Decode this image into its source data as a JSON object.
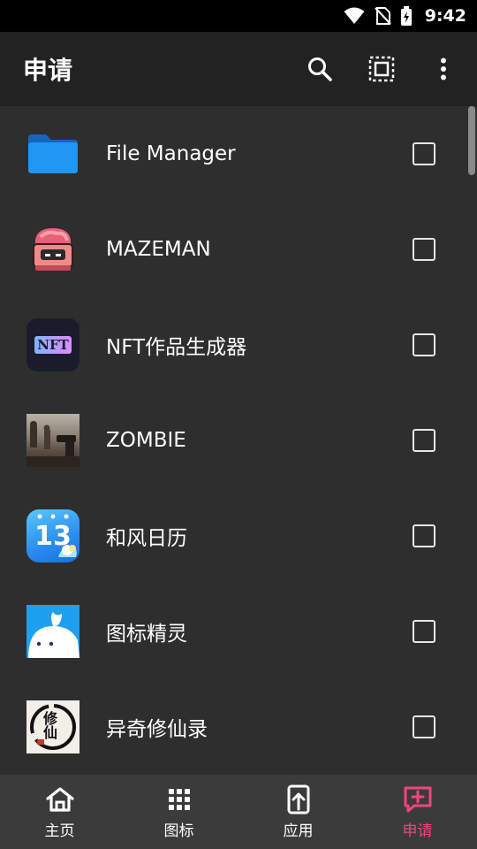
{
  "status_bar": {
    "time": "9:42",
    "icons": [
      "wifi-icon",
      "no-sim-icon",
      "battery-charging-icon"
    ]
  },
  "app_bar": {
    "title": "申请",
    "actions": [
      "search-icon",
      "select-all-icon",
      "more-vert-icon"
    ]
  },
  "apps": [
    {
      "name": "File Manager",
      "icon": "folder-icon",
      "checked": false
    },
    {
      "name": "MAZEMAN",
      "icon": "mazeman-icon",
      "checked": false
    },
    {
      "name": "NFT作品生成器",
      "icon": "nft-icon",
      "icon_text": "NFT",
      "checked": false
    },
    {
      "name": "ZOMBIE",
      "icon": "zombie-icon",
      "checked": false
    },
    {
      "name": "和风日历",
      "icon": "calendar-icon",
      "icon_text": "13",
      "checked": false
    },
    {
      "name": "图标精灵",
      "icon": "whale-icon",
      "checked": false
    },
    {
      "name": "异奇修仙录",
      "icon": "xiuxian-icon",
      "icon_text": "修仙",
      "checked": false
    }
  ],
  "bottom_nav": {
    "items": [
      {
        "label": "主页",
        "icon": "home-icon",
        "active": false
      },
      {
        "label": "图标",
        "icon": "grid-icon",
        "active": false
      },
      {
        "label": "应用",
        "icon": "apps-upload-icon",
        "active": false
      },
      {
        "label": "申请",
        "icon": "request-icon",
        "active": true
      }
    ]
  },
  "colors": {
    "accent": "#f0457f",
    "background": "#2e2e2e",
    "app_bar": "#222222",
    "bottom_nav": "#3b3b3b"
  }
}
